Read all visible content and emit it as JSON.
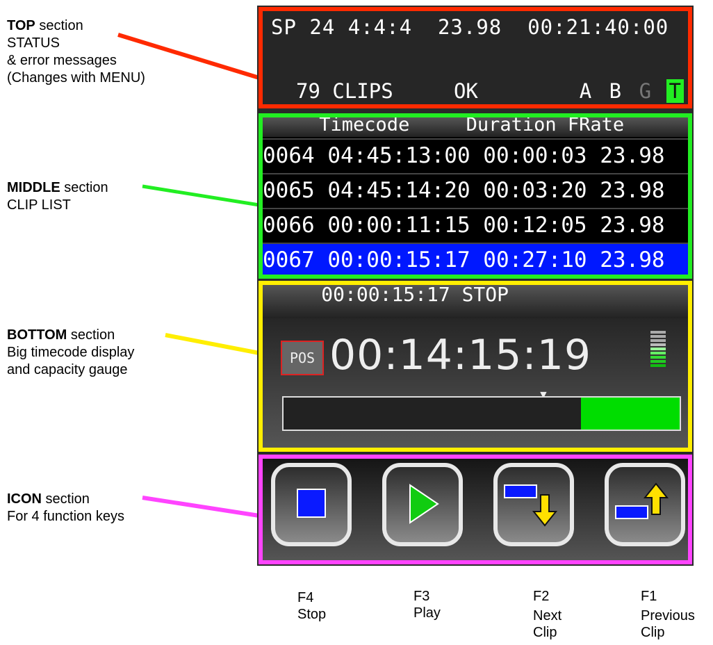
{
  "annotations": {
    "top": {
      "bold": "TOP",
      "rest": " section",
      "lines": [
        "STATUS",
        "& error messages",
        "(Changes with MENU)"
      ]
    },
    "middle": {
      "bold": "MIDDLE",
      "rest": " section",
      "lines": [
        "CLIP LIST"
      ]
    },
    "bottom": {
      "bold": "BOTTOM",
      "rest": " section",
      "lines": [
        "Big timecode display",
        "and capacity gauge"
      ]
    },
    "icon": {
      "bold": "ICON",
      "rest": " section",
      "lines": [
        "For 4 function keys"
      ]
    }
  },
  "status": {
    "line1": "SP 24 4:4:4  23.98  00:21:40:00",
    "line2": "79 CLIPS     OK",
    "flags": [
      "A",
      "B",
      "G",
      "T"
    ]
  },
  "clip_list": {
    "header": "     Timecode     Duration FRate",
    "rows": [
      "0064 04:45:13:00 00:00:03 23.98",
      "0065 04:45:14:20 00:03:20 23.98",
      "0066 00:00:11:15 00:12:05 23.98",
      "0067 00:00:15:17 00:27:10 23.98"
    ],
    "selected_index": 3
  },
  "transport": {
    "strip_text": "     00:00:15:17 STOP",
    "pos_label": "POS",
    "big_timecode": "00:14:15:19",
    "capacity_used_fraction": 0.75
  },
  "function_keys": [
    {
      "key": "F4",
      "label_lines": [
        "Stop"
      ],
      "icon": "stop-icon"
    },
    {
      "key": "F3",
      "label_lines": [
        "Play"
      ],
      "icon": "play-icon"
    },
    {
      "key": "F2",
      "label_lines": [
        "Next",
        "Clip"
      ],
      "icon": "next-clip-icon"
    },
    {
      "key": "F1",
      "label_lines": [
        "Previous",
        "Clip"
      ],
      "icon": "previous-clip-icon"
    }
  ],
  "colors": {
    "top": "#ff2a00",
    "middle": "#22ee22",
    "bottom": "#ffee00",
    "icon": "#ff44ff"
  }
}
